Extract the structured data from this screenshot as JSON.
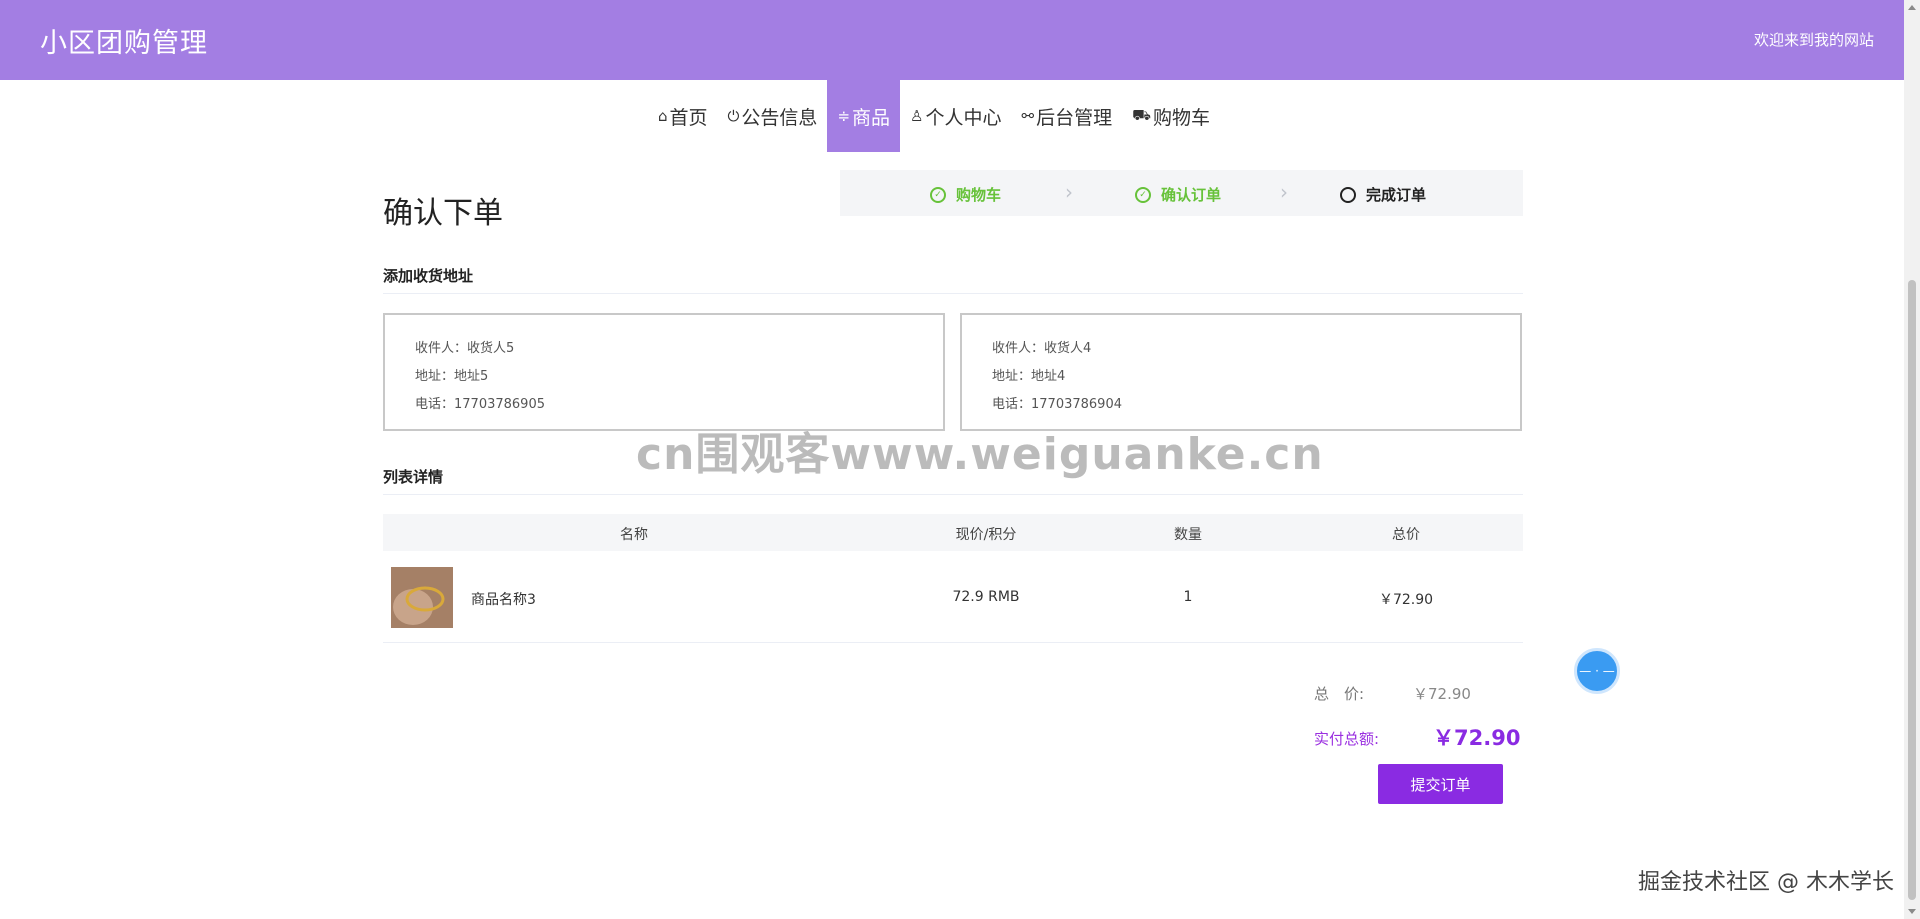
{
  "header": {
    "brand": "小区团购管理",
    "welcome": "欢迎来到我的网站"
  },
  "nav": [
    {
      "icon": "⌂",
      "icon_name": "home-icon",
      "label": "首页",
      "active": false
    },
    {
      "icon": "⏻",
      "icon_name": "power-icon",
      "label": "公告信息",
      "active": false
    },
    {
      "icon": "≑",
      "icon_name": "sliders-icon",
      "label": "商品",
      "active": true
    },
    {
      "icon": "♙",
      "icon_name": "user-icon",
      "label": "个人中心",
      "active": false
    },
    {
      "icon": "⚯",
      "icon_name": "link-icon",
      "label": "后台管理",
      "active": false
    },
    {
      "icon": "⛟",
      "icon_name": "cart-icon",
      "label": "购物车",
      "active": false
    }
  ],
  "page": {
    "title": "确认下单"
  },
  "steps": [
    {
      "label": "购物车",
      "status": "done"
    },
    {
      "label": "确认订单",
      "status": "done"
    },
    {
      "label": "完成订单",
      "status": "current"
    }
  ],
  "address_section": {
    "title": "添加收货地址"
  },
  "addresses": [
    {
      "receiver": "收件人：收货人5",
      "address": "地址：地址5",
      "phone": "电话：17703786905"
    },
    {
      "receiver": "收件人：收货人4",
      "address": "地址：地址4",
      "phone": "电话：17703786904"
    }
  ],
  "list_section": {
    "title": "列表详情"
  },
  "table": {
    "headers": [
      "名称",
      "现价/积分",
      "数量",
      "总价"
    ],
    "rows": [
      {
        "name": "商品名称3",
        "price": "72.9 RMB",
        "qty": "1",
        "total": "￥72.90"
      }
    ]
  },
  "summary": {
    "total_label": "总　价:",
    "total_value": "￥72.90",
    "pay_label": "实付总额:",
    "pay_value": "￥72.90",
    "submit_label": "提交订单"
  },
  "float_button": {
    "label": "— · —"
  },
  "watermark": "cn围观客www.weiguanke.cn",
  "footer_mark": "掘金技术社区 @ 木木学长",
  "colors": {
    "header": "#a37ee3",
    "accent": "#8a2be2",
    "step_done": "#67c23a"
  }
}
